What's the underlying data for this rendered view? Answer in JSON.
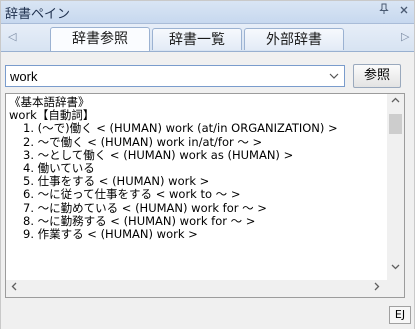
{
  "pane": {
    "title": "辞書ペイン",
    "pin_icon": "pin-icon",
    "close_icon": "close-icon"
  },
  "tabs": [
    {
      "label": "辞書参照",
      "active": true
    },
    {
      "label": "辞書一覧",
      "active": false
    },
    {
      "label": "外部辞書",
      "active": false
    }
  ],
  "search": {
    "value": "work",
    "button_label": "参照"
  },
  "result": {
    "dictionary": "《基本語辞書》",
    "headword": "work【自動詞】",
    "senses": [
      "1. (〜で)働く < (HUMAN) work (at/in ORGANIZATION) >",
      "2. 〜で働く < (HUMAN) work in/at/for 〜 >",
      "3. 〜として働く < (HUMAN) work as (HUMAN) >",
      "4. 働いている",
      "5. 仕事をする < (HUMAN) work >",
      "6. 〜に従って仕事をする < work to 〜 >",
      "7. 〜に勤めている < (HUMAN) work for 〜 >",
      "8. 〜に勤務する < (HUMAN) work for 〜 >",
      "9. 作業する < (HUMAN) work >"
    ]
  },
  "status": {
    "mode": "EJ"
  },
  "colors": {
    "title_bg": "#c7d8ef",
    "tab_border": "#9bb2d2"
  }
}
